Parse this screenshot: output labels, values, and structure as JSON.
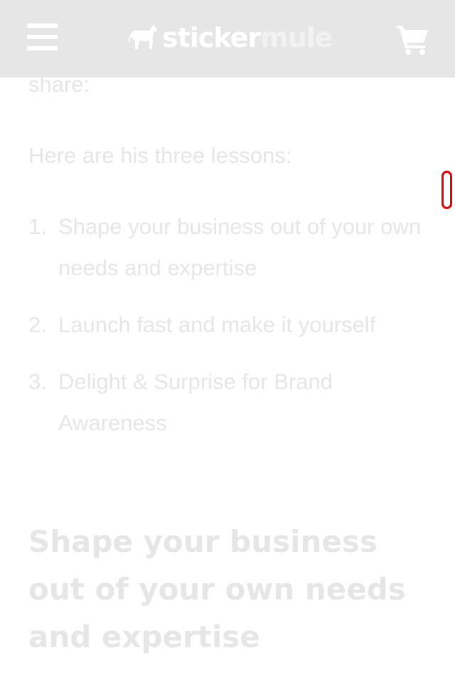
{
  "header": {
    "logo_part1": "sticker",
    "logo_part2": "mule"
  },
  "article": {
    "partial_paragraph": "share:",
    "intro": "Here are his three lessons:",
    "lessons": [
      {
        "number": "1.",
        "text": "Shape your business out of your own needs and expertise"
      },
      {
        "number": "2.",
        "text": "Launch fast and make it yourself"
      },
      {
        "number": "3.",
        "text": "Delight & Surprise for Brand Awareness"
      }
    ],
    "section_heading": "Shape your business out of your own needs and expertise"
  },
  "colors": {
    "header_bg": "#e6e6e6",
    "text_faded": "#e6e6e6",
    "accent": "#e60000"
  }
}
